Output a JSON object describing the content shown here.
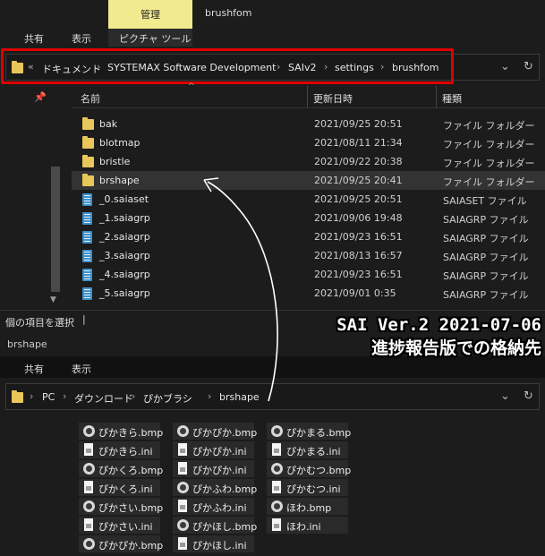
{
  "ribbon": {
    "context_group": "管理",
    "window_title": "brushfom",
    "tabs": [
      "共有",
      "表示",
      "ピクチャ ツール"
    ]
  },
  "address1": {
    "prefix": "«",
    "crumbs": [
      "ドキュメント",
      "SYSTEMAX Software Development",
      "SAIv2",
      "settings",
      "brushfom"
    ]
  },
  "list": {
    "columns": [
      "名前",
      "更新日時",
      "種類"
    ],
    "rows": [
      {
        "name": "bak",
        "date": "2021/09/25 20:51",
        "type": "ファイル フォルダー",
        "kind": "folder"
      },
      {
        "name": "blotmap",
        "date": "2021/08/11 21:34",
        "type": "ファイル フォルダー",
        "kind": "folder"
      },
      {
        "name": "bristle",
        "date": "2021/09/22 20:38",
        "type": "ファイル フォルダー",
        "kind": "folder"
      },
      {
        "name": "brshape",
        "date": "2021/09/25 20:41",
        "type": "ファイル フォルダー",
        "kind": "folder"
      },
      {
        "name": "_0.saiaset",
        "date": "2021/09/25 20:51",
        "type": "SAIASET ファイル",
        "kind": "file"
      },
      {
        "name": "_1.saiagrp",
        "date": "2021/09/06 19:48",
        "type": "SAIAGRP ファイル",
        "kind": "file"
      },
      {
        "name": "_2.saiagrp",
        "date": "2021/09/23 16:51",
        "type": "SAIAGRP ファイル",
        "kind": "file"
      },
      {
        "name": "_3.saiagrp",
        "date": "2021/08/13 16:57",
        "type": "SAIAGRP ファイル",
        "kind": "file"
      },
      {
        "name": "_4.saiagrp",
        "date": "2021/09/23 16:51",
        "type": "SAIAGRP ファイル",
        "kind": "file"
      },
      {
        "name": "_5.saiagrp",
        "date": "2021/09/01 0:35",
        "type": "SAIAGRP ファイル",
        "kind": "file"
      }
    ]
  },
  "status": {
    "text": "個の項目を選択"
  },
  "window2": {
    "title": "brshape",
    "tabs": [
      "共有",
      "表示"
    ],
    "crumbs": [
      "PC",
      "ダウンロード",
      "ぴかブラシ",
      "brshape"
    ],
    "tiles": [
      {
        "name": "ぴかきら.bmp",
        "kind": "bmp"
      },
      {
        "name": "ぴかぴか.bmp",
        "kind": "bmp"
      },
      {
        "name": "ぴかまる.bmp",
        "kind": "bmp"
      },
      {
        "name": "ぴかきら.ini",
        "kind": "ini"
      },
      {
        "name": "ぴかぴか.ini",
        "kind": "ini"
      },
      {
        "name": "ぴかまる.ini",
        "kind": "ini"
      },
      {
        "name": "ぴかくろ.bmp",
        "kind": "bmp"
      },
      {
        "name": "ぴかぴか.ini",
        "kind": "ini"
      },
      {
        "name": "ぴかむつ.bmp",
        "kind": "bmp"
      },
      {
        "name": "ぴかくろ.ini",
        "kind": "ini"
      },
      {
        "name": "ぴかふわ.bmp",
        "kind": "bmp"
      },
      {
        "name": "ぴかむつ.ini",
        "kind": "ini"
      },
      {
        "name": "ぴかさい.bmp",
        "kind": "bmp"
      },
      {
        "name": "ぴかふわ.ini",
        "kind": "ini"
      },
      {
        "name": "ほわ.bmp",
        "kind": "bmp"
      },
      {
        "name": "ぴかさい.ini",
        "kind": "ini"
      },
      {
        "name": "ぴかほし.bmp",
        "kind": "bmp"
      },
      {
        "name": "ほわ.ini",
        "kind": "ini"
      },
      {
        "name": "ぴかぴか.bmp",
        "kind": "bmp"
      },
      {
        "name": "ぴかほし.ini",
        "kind": "ini"
      }
    ]
  },
  "annotation": {
    "line1": "SAI Ver.2 2021-07-06",
    "line2": "進捗報告版での格納先"
  },
  "colors": {
    "highlight": "#e00000",
    "folder": "#e8c65a",
    "context_group": "#f2ea8f"
  }
}
